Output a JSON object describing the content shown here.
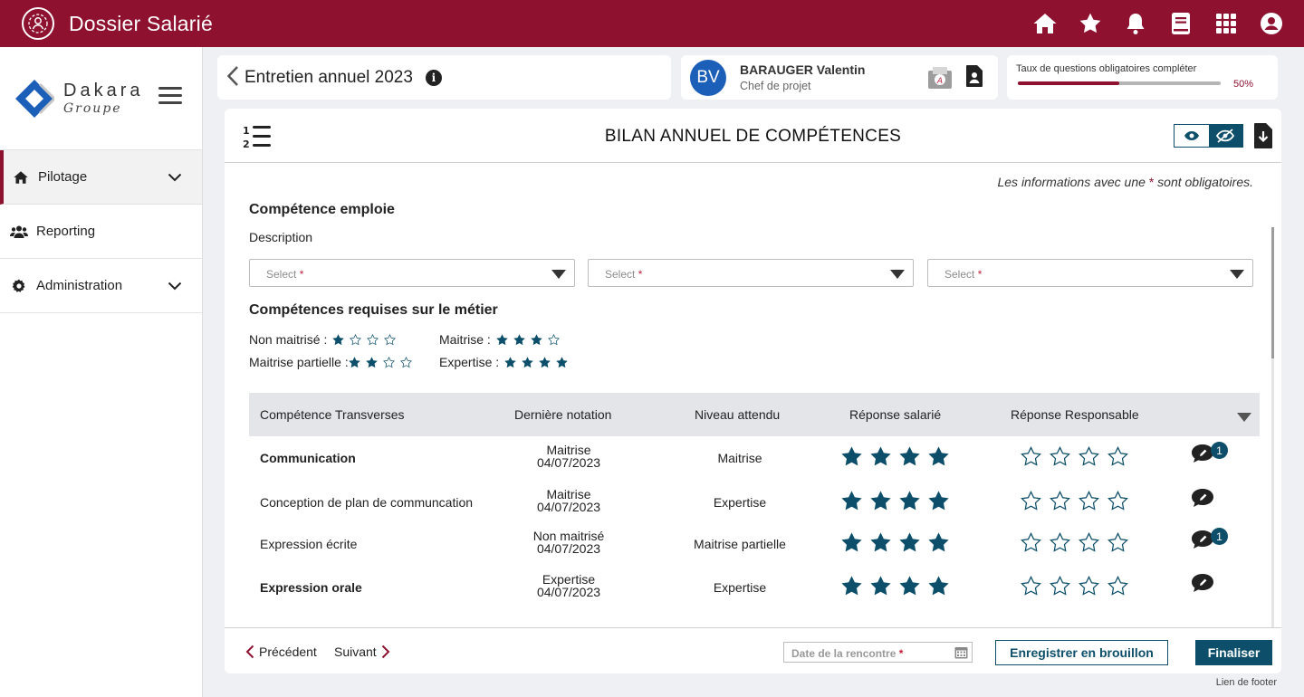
{
  "topbar": {
    "title": "Dossier Salarié",
    "icons": [
      "home-icon",
      "star-icon",
      "bell-icon",
      "book-icon",
      "apps-grid-icon",
      "user-icon"
    ]
  },
  "brand": {
    "name": "Dakara",
    "sub": "Groupe"
  },
  "sidebar": {
    "items": [
      {
        "label": "Pilotage",
        "icon": "home-icon"
      },
      {
        "label": "Reporting",
        "icon": "users-icon"
      },
      {
        "label": "Administration",
        "icon": "gear-icon"
      }
    ]
  },
  "header": {
    "title": "Entretien annuel 2023"
  },
  "person": {
    "initials": "BV",
    "name": "BARAUGER Valentin",
    "role": "Chef de projet"
  },
  "progress": {
    "label": "Taux de questions obligatoires compléter",
    "value_text": "50%",
    "percent": 50
  },
  "main": {
    "title": "BILAN ANNUEL DE COMPÉTENCES",
    "required_note": "Les informations avec une",
    "required_star": "*",
    "required_note_end": "sont obligatoires.",
    "section1": "Compétence emploie",
    "description_label": "Description",
    "select_placeholder": "Select",
    "select_star": "*",
    "section2": "Compétences requises sur le métier",
    "legend": [
      {
        "label": "Non maitrisé :",
        "filled": 1
      },
      {
        "label": "Maitrise partielle :",
        "filled": 2
      },
      {
        "label": "Maitrise :",
        "filled": 3
      },
      {
        "label": "Expertise :",
        "filled": 4
      }
    ]
  },
  "table": {
    "headers": [
      "Compétence Transverses",
      "Dernière notation",
      "Niveau attendu",
      "Réponse salarié",
      "Réponse Responsable"
    ],
    "rows": [
      {
        "name": "Communication",
        "last_level": "Maitrise",
        "last_date": "04/07/2023",
        "expected": "Maitrise",
        "employee_stars": 4,
        "manager_stars": 0,
        "comments": "1"
      },
      {
        "name": "Conception de plan de communcation",
        "last_level": "Maitrise",
        "last_date": "04/07/2023",
        "expected": "Expertise",
        "employee_stars": 4,
        "manager_stars": 0,
        "comments": ""
      },
      {
        "name": "Expression écrite",
        "last_level": "Non maitrisé",
        "last_date": "04/07/2023",
        "expected": "Maitrise partielle",
        "employee_stars": 4,
        "manager_stars": 0,
        "comments": "1"
      },
      {
        "name": "Expression orale",
        "last_level": "Expertise",
        "last_date": "04/07/2023",
        "expected": "Expertise",
        "employee_stars": 4,
        "manager_stars": 0,
        "comments": ""
      }
    ]
  },
  "footer": {
    "prev": "Précédent",
    "next": "Suivant",
    "date_placeholder": "Date de la rencontre",
    "date_star": "*",
    "draft_button": "Enregistrer en brouillon",
    "finalize_button": "Finaliser",
    "footer_link": "Lien de footer"
  },
  "colors": {
    "brand": "#8e1230",
    "accent": "#0d4f6a",
    "star": "#0d4f6a"
  }
}
